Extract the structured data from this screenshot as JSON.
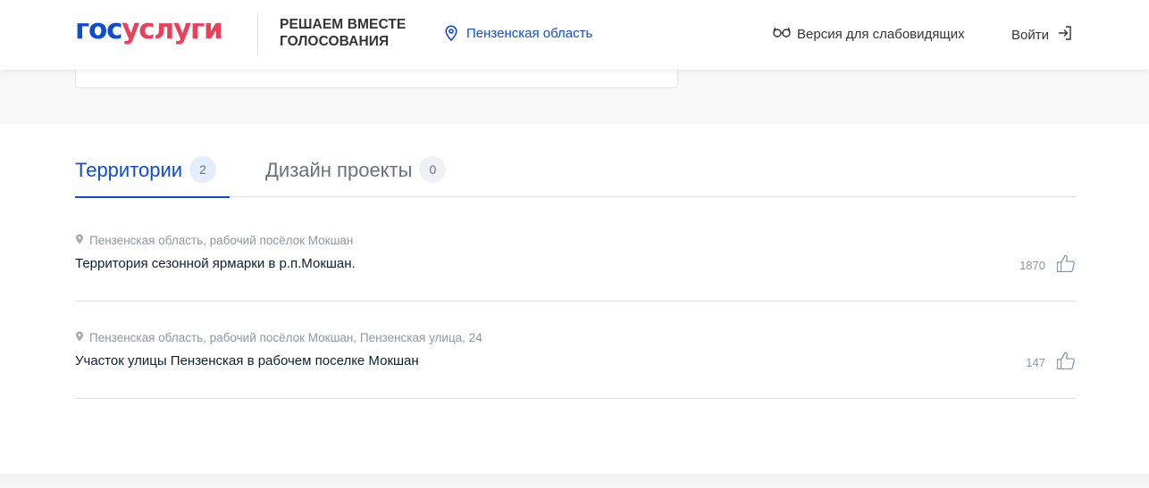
{
  "header": {
    "logo_part1": "гос",
    "logo_part2": "услуги",
    "slogan_line1": "РЕШАЕМ ВМЕСТЕ",
    "slogan_line2": "ГОЛОСОВАНИЯ",
    "region": "Пензенская область",
    "vision_label": "Версия для слабовидящих",
    "login_label": "Войти"
  },
  "tabs": [
    {
      "label": "Территории",
      "count": "2",
      "active": true
    },
    {
      "label": "Дизайн проекты",
      "count": "0",
      "active": false
    }
  ],
  "items": [
    {
      "address": "Пензенская область, рабочий посёлок Мокшан",
      "title": "Территория сезонной ярмарки в р.п.Мокшан.",
      "votes": "1870"
    },
    {
      "address": "Пензенская область, рабочий посёлок Мокшан, Пензенская улица, 24",
      "title": "Участок улицы Пензенская в рабочем поселке Мокшан",
      "votes": "147"
    }
  ],
  "colors": {
    "brand_blue": "#0d4cd3",
    "brand_red": "#ee3f58",
    "muted": "#8b97a3"
  }
}
